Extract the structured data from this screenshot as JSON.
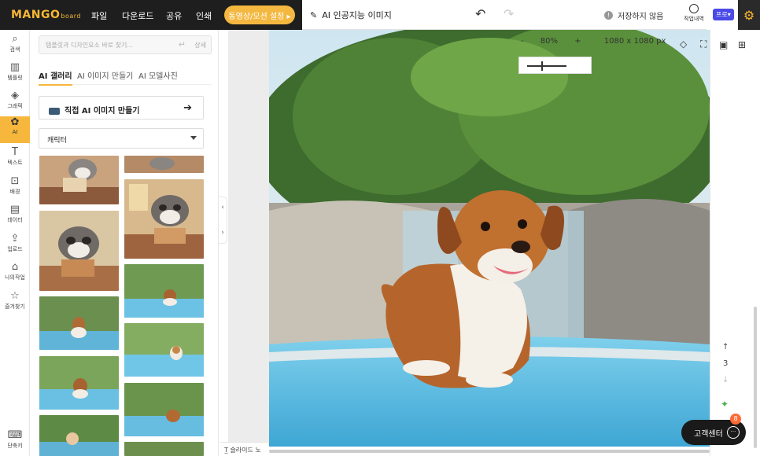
{
  "app": {
    "logo": "MANGO",
    "logo_sub": "board"
  },
  "menu": [
    "파일",
    "다운로드",
    "공유",
    "인쇄"
  ],
  "motion_button": "동영상/모션 설정 ▸",
  "doc_title": "AI 인공지능 이미지",
  "save_status": "저장하지 않음",
  "history_label": "작업내역",
  "pro_label": "프로▾",
  "rail": [
    {
      "label": "검색",
      "icon": "search-icon"
    },
    {
      "label": "템플릿",
      "icon": "template-icon"
    },
    {
      "label": "그래픽",
      "icon": "graphic-icon"
    },
    {
      "label": "AI",
      "icon": "ai-icon",
      "active": true
    },
    {
      "label": "텍스트",
      "icon": "text-icon"
    },
    {
      "label": "배경",
      "icon": "background-icon"
    },
    {
      "label": "데이터",
      "icon": "chart-icon"
    },
    {
      "label": "업로드",
      "icon": "upload-icon"
    },
    {
      "label": "나의작업",
      "icon": "mywork-icon"
    },
    {
      "label": "즐겨찾기",
      "icon": "star-icon"
    }
  ],
  "shortcut_label": "단축키",
  "search": {
    "placeholder": "템플릿과 디자인요소 바로 찾기...",
    "detail": "상세"
  },
  "tabs": [
    "AI 갤러리",
    "AI 이미지 만들기",
    "AI 모델사진"
  ],
  "make_button": "직접 AI 이미지 만들기",
  "category": "캐릭터",
  "zoom": {
    "minus": "-",
    "value": "80%",
    "plus": "+",
    "size": "1080 x 1080 px"
  },
  "slide_note": "슬라이드 노트",
  "page_number": "3",
  "help": {
    "label": "고객센터",
    "badge": "8"
  }
}
